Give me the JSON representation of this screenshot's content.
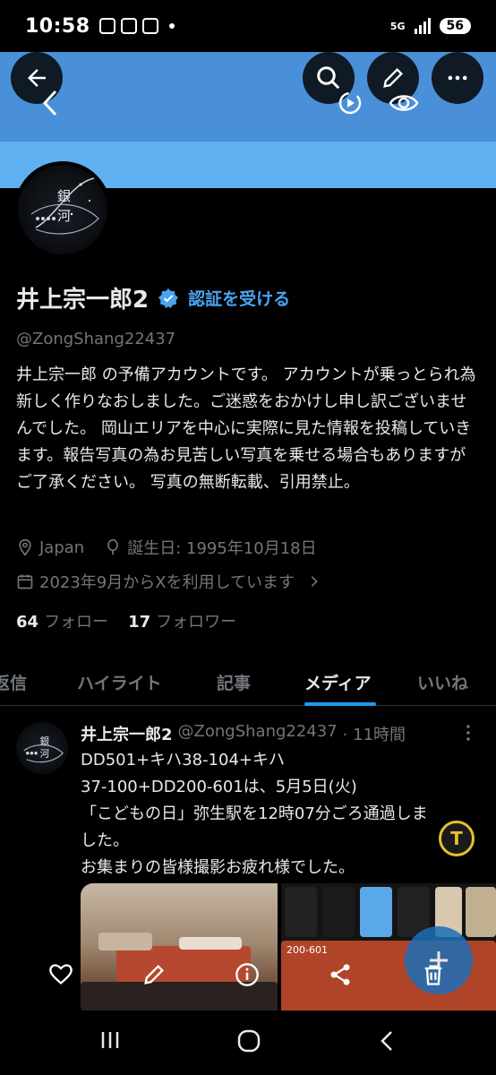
{
  "status_bar": {
    "time": "10:58",
    "network": "5G",
    "battery": "56"
  },
  "profile": {
    "name": "井上宗一郎2",
    "verify_link": "認証を受ける",
    "handle": "@ZongShang22437",
    "bio": "井上宗一郎 の予備アカウントです。 アカウントが乗っとられ為新しく作りなおしました。ご迷惑をおかけし申し訳ございませんでした。 岡山エリアを中心に実際に見た情報を投稿していきます。報告写真の為お見苦しい写真を乗せる場合もありますがご了承ください。 写真の無断転載、引用禁止。",
    "location": "Japan",
    "birthday": "誕生日: 1995年10月18日",
    "joined": "2023年9月からXを利用しています",
    "following_count": "64",
    "following_label": "フォロー",
    "followers_count": "17",
    "followers_label": "フォロワー"
  },
  "avatar_text": {
    "line1": "銀",
    "line2": "河"
  },
  "tabs": [
    {
      "label": "返信"
    },
    {
      "label": "ハイライト"
    },
    {
      "label": "記事"
    },
    {
      "label": "メディア"
    },
    {
      "label": "いいね"
    }
  ],
  "tweet": {
    "name": "井上宗一郎2",
    "handle": "@ZongShang22437",
    "time": "· 11時間",
    "line1": "DD501+キハ38-104+キハ",
    "line2": "37-100+DD200-601は、5月5日(火)",
    "line3": "「こどもの日」弥生駅を12時07分ごろ通過しま",
    "line4": "した。",
    "line5": "お集まりの皆様撮影お疲れ様でした。"
  },
  "media_text": {
    "loco_number": "200-601"
  },
  "colors": {
    "accent": "#1d9bf0",
    "banner": "#4a90d9",
    "banner_strip": "#5fb0f0",
    "verify": "#4aa3f0"
  }
}
